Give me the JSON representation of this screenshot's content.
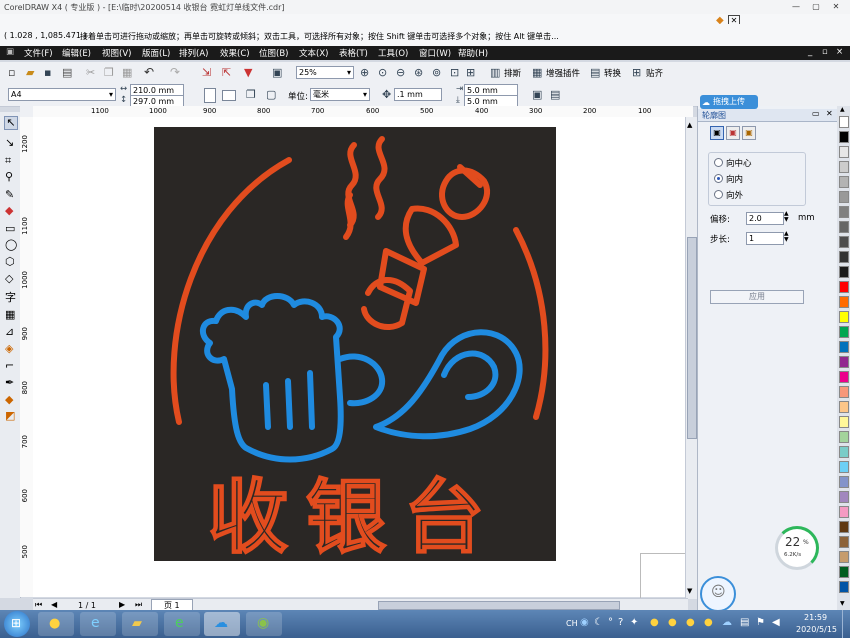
{
  "window": {
    "title": "CorelDRAW X4 ( 专业版 ) - [E:\\临时\\20200514 收银台 霓虹灯单线文件.cdr]"
  },
  "statusbar": {
    "coords": "( 1.028 , 1,085.471 )",
    "hint": "接着单击可进行拖动或缩放；再单击可旋转或倾斜；双击工具，可选择所有对象；按住 Shift 键单击可选择多个对象；按住 Alt 键单击..."
  },
  "menu": [
    "文件(F)",
    "编辑(E)",
    "视图(V)",
    "版面(L)",
    "排列(A)",
    "效果(C)",
    "位图(B)",
    "文本(X)",
    "表格(T)",
    "工具(O)",
    "窗口(W)",
    "帮助(H)"
  ],
  "toolbar1": {
    "zoom": "25%",
    "buttons": [
      "排斯",
      "增强插件",
      "转换",
      "贴齐"
    ]
  },
  "property_bar": {
    "paper": "A4",
    "width": "210.0 mm",
    "height": "297.0 mm",
    "units_label": "单位:",
    "units": "毫米",
    "nudge": ".1 mm",
    "dup_x": "5.0 mm",
    "dup_y": "5.0 mm"
  },
  "ruler_h": [
    "1100",
    "1000",
    "900",
    "800",
    "700",
    "600",
    "500",
    "400",
    "300",
    "200",
    "100"
  ],
  "ruler_v": [
    "1200",
    "1100",
    "1000",
    "900",
    "800",
    "700",
    "600",
    "500"
  ],
  "artwork": {
    "text": "收银台",
    "bg_color": "#2a2725",
    "orange": "#e24c1e",
    "blue": "#1f8be0"
  },
  "docker": {
    "upload_button": "拖拽上传",
    "title": "轮廓图",
    "options": [
      "向中心",
      "向内",
      "向外"
    ],
    "selected_option": "向内",
    "offset_label": "偏移:",
    "offset_value": "2.0",
    "offset_unit": "mm",
    "steps_label": "步长:",
    "steps_value": "1",
    "apply_button": "应用"
  },
  "palette_colors": [
    "#ffffff",
    "#000000",
    "#e6e6e6",
    "#cccccc",
    "#b3b3b3",
    "#999999",
    "#808080",
    "#666666",
    "#4d4d4d",
    "#333333",
    "#1a1a1a",
    "#ff0000",
    "#ff6a00",
    "#ffff00",
    "#00a651",
    "#0072bc",
    "#92278f",
    "#ec008c",
    "#f7977a",
    "#fdc689",
    "#fff799",
    "#a3d39c",
    "#7accc8",
    "#6dcff6",
    "#8393ca",
    "#a187be",
    "#f49ac2",
    "#603913",
    "#8c6239",
    "#c69c6d",
    "#005e20",
    "#0054a6"
  ],
  "netmeter": {
    "percent": "22",
    "speed": "6.2K/s"
  },
  "page_nav": {
    "page_count": "1 / 1",
    "page_tab": "页 1"
  },
  "taskbar": {
    "time": "21:59",
    "date": "2020/5/15",
    "tray_lang": "CH"
  }
}
